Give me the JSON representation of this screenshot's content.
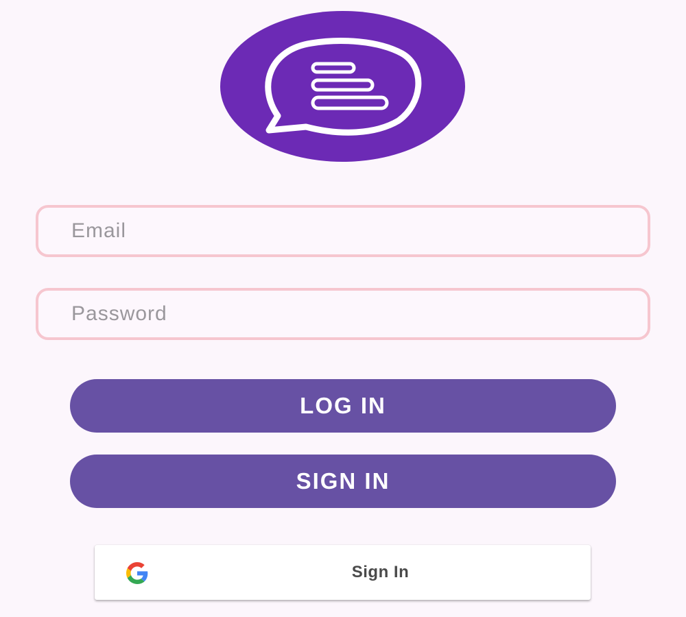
{
  "logo": {
    "icon": "chat-bubble-lines-icon",
    "circle_color": "#6c2ab5"
  },
  "form": {
    "email_placeholder": "Email",
    "password_placeholder": "Password",
    "field_border_color": "#f6c6cf"
  },
  "buttons": {
    "login_label": "LOG IN",
    "signin_label": "SIGN IN",
    "button_color": "#6751a4"
  },
  "google": {
    "icon": "google-g-icon",
    "label": "Sign In"
  }
}
